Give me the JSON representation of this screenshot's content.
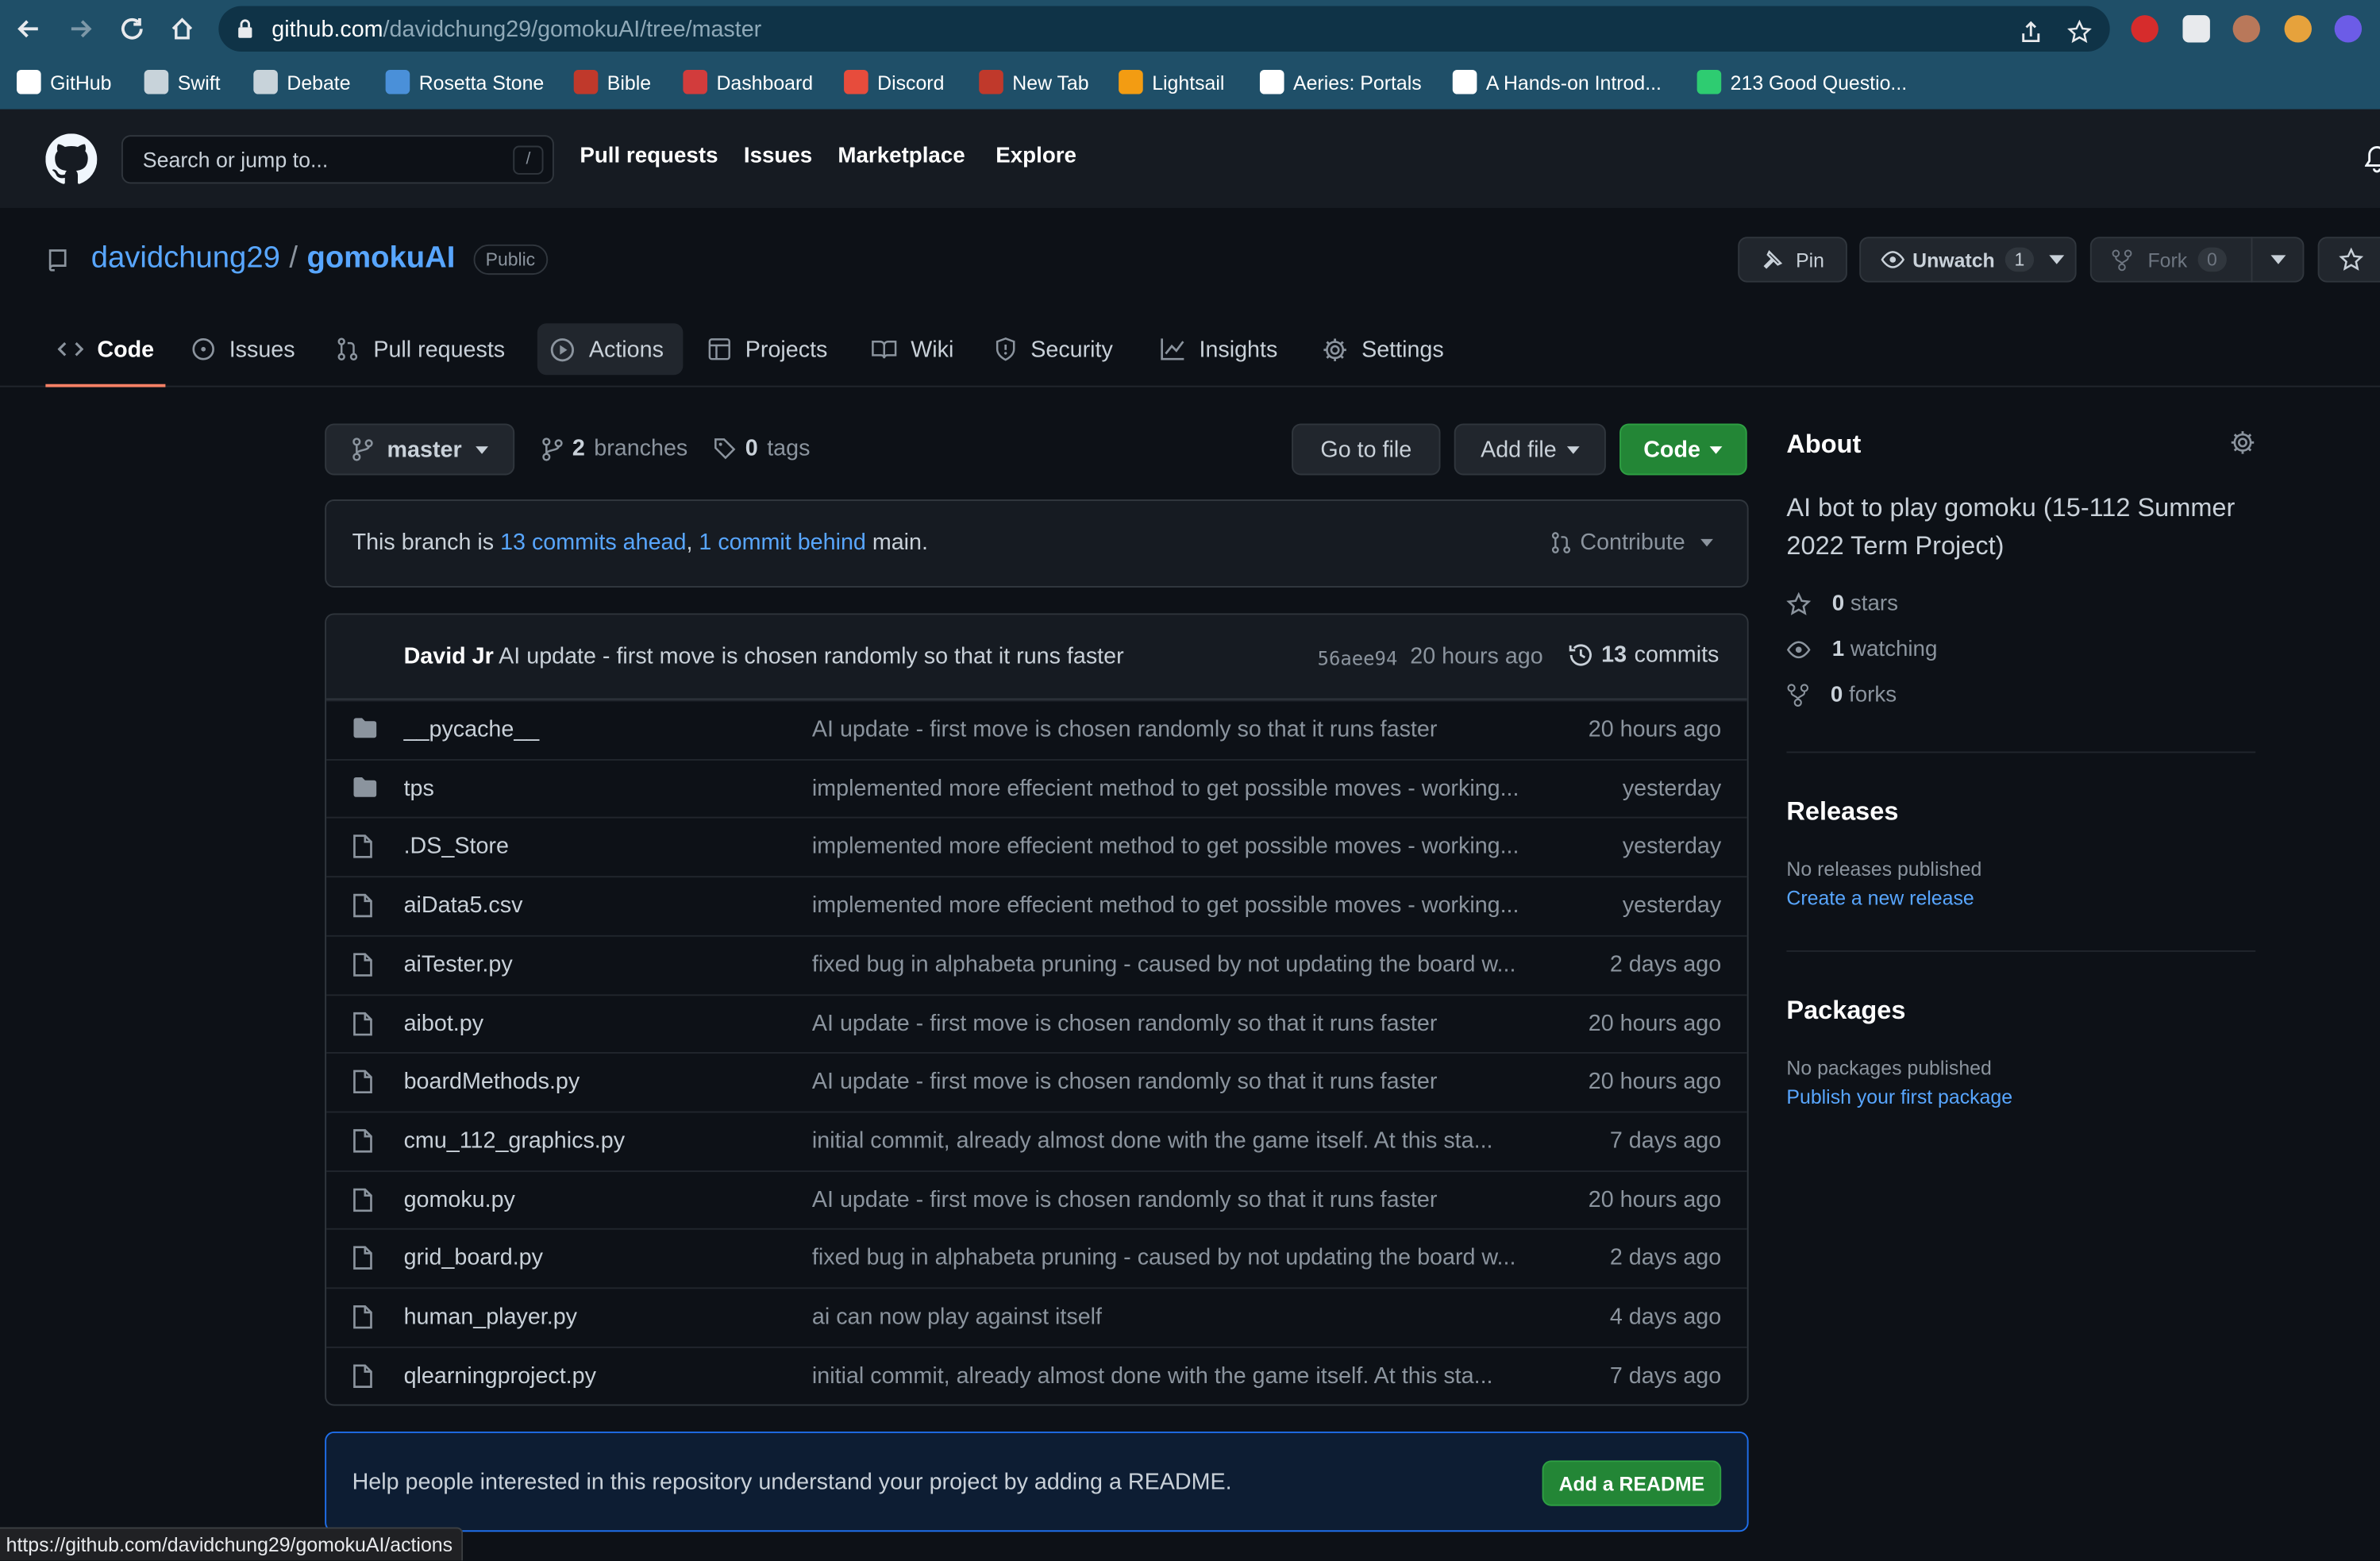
{
  "browser": {
    "url_host": "github.com",
    "url_path": "/davidchung29/gomokuAI/tree/master",
    "bookmarks": [
      {
        "label": "GitHub",
        "color": "#ffffff"
      },
      {
        "label": "Swift",
        "color": "#c8d3da"
      },
      {
        "label": "Debate",
        "color": "#c8d3da"
      },
      {
        "label": "Rosetta Stone",
        "color": "#4a90d9"
      },
      {
        "label": "Bible",
        "color": "#c0392b"
      },
      {
        "label": "Dashboard",
        "color": "#d23c3c"
      },
      {
        "label": "Discord",
        "color": "#e74c3c"
      },
      {
        "label": "New Tab",
        "color": "#c0392b"
      },
      {
        "label": "Lightsail",
        "color": "#f39c12"
      },
      {
        "label": "Aeries: Portals",
        "color": "#ffffff"
      },
      {
        "label": "A Hands-on Introd...",
        "color": "#ffffff"
      },
      {
        "label": "213 Good Questio...",
        "color": "#2ecc71"
      }
    ],
    "status_url": "https://github.com/davidchung29/gomokuAI/actions"
  },
  "gh_header": {
    "search_placeholder": "Search or jump to...",
    "search_shortcut": "/",
    "nav": [
      "Pull requests",
      "Issues",
      "Marketplace",
      "Explore"
    ]
  },
  "repo": {
    "owner": "davidchung29",
    "separator": "/",
    "name": "gomokuAI",
    "visibility": "Public",
    "pin_label": "Pin",
    "unwatch_label": "Unwatch",
    "watch_count": "1",
    "fork_label": "Fork",
    "fork_count": "0"
  },
  "tabs": [
    {
      "label": "Code",
      "icon": "code-icon"
    },
    {
      "label": "Issues",
      "icon": "issue-icon"
    },
    {
      "label": "Pull requests",
      "icon": "pull-request-icon"
    },
    {
      "label": "Actions",
      "icon": "play-icon"
    },
    {
      "label": "Projects",
      "icon": "table-icon"
    },
    {
      "label": "Wiki",
      "icon": "book-icon"
    },
    {
      "label": "Security",
      "icon": "shield-icon"
    },
    {
      "label": "Insights",
      "icon": "graph-icon"
    },
    {
      "label": "Settings",
      "icon": "gear-icon"
    }
  ],
  "branch_bar": {
    "branch": "master",
    "branches_count": "2",
    "branches_label": "branches",
    "tags_count": "0",
    "tags_label": "tags",
    "go_to_file": "Go to file",
    "add_file": "Add file",
    "code": "Code"
  },
  "ahead_behind": {
    "prefix": "This branch is",
    "ahead": "13 commits ahead",
    "comma": ",",
    "behind": "1 commit behind",
    "suffix": "main.",
    "contribute": "Contribute"
  },
  "latest_commit": {
    "author": "David Jr",
    "message": "AI update - first move is chosen randomly so that it runs faster",
    "sha": "56aee94",
    "time": "20 hours ago",
    "commits_count": "13",
    "commits_label": "commits"
  },
  "files": [
    {
      "type": "dir",
      "name": "__pycache__",
      "message": "AI update - first move is chosen randomly so that it runs faster",
      "time": "20 hours ago"
    },
    {
      "type": "dir",
      "name": "tps",
      "message": "implemented more effecient method to get possible moves - working...",
      "time": "yesterday"
    },
    {
      "type": "file",
      "name": ".DS_Store",
      "message": "implemented more effecient method to get possible moves - working...",
      "time": "yesterday"
    },
    {
      "type": "file",
      "name": "aiData5.csv",
      "message": "implemented more effecient method to get possible moves - working...",
      "time": "yesterday"
    },
    {
      "type": "file",
      "name": "aiTester.py",
      "message": "fixed bug in alphabeta pruning - caused by not updating the board w...",
      "time": "2 days ago"
    },
    {
      "type": "file",
      "name": "aibot.py",
      "message": "AI update - first move is chosen randomly so that it runs faster",
      "time": "20 hours ago"
    },
    {
      "type": "file",
      "name": "boardMethods.py",
      "message": "AI update - first move is chosen randomly so that it runs faster",
      "time": "20 hours ago"
    },
    {
      "type": "file",
      "name": "cmu_112_graphics.py",
      "message": "initial commit, already almost done with the game itself. At this sta...",
      "time": "7 days ago"
    },
    {
      "type": "file",
      "name": "gomoku.py",
      "message": "AI update - first move is chosen randomly so that it runs faster",
      "time": "20 hours ago"
    },
    {
      "type": "file",
      "name": "grid_board.py",
      "message": "fixed bug in alphabeta pruning - caused by not updating the board w...",
      "time": "2 days ago"
    },
    {
      "type": "file",
      "name": "human_player.py",
      "message": "ai can now play against itself",
      "time": "4 days ago"
    },
    {
      "type": "file",
      "name": "qlearningproject.py",
      "message": "initial commit, already almost done with the game itself. At this sta...",
      "time": "7 days ago"
    }
  ],
  "readme_prompt": {
    "text": "Help people interested in this repository understand your project by adding a README.",
    "button": "Add a README"
  },
  "sidebar": {
    "about_title": "About",
    "description": "AI bot to play gomoku (15-112 Summer 2022 Term Project)",
    "stars_count": "0",
    "stars_label": "stars",
    "watching_count": "1",
    "watching_label": "watching",
    "forks_count": "0",
    "forks_label": "forks",
    "releases_title": "Releases",
    "releases_none": "No releases published",
    "releases_link": "Create a new release",
    "packages_title": "Packages",
    "packages_none": "No packages published",
    "packages_link": "Publish your first package"
  },
  "colors": {
    "accent_link": "#58a6ff",
    "code_button": "#238636",
    "tab_underline": "#f78166",
    "browser_chrome": "#1f4f68"
  }
}
